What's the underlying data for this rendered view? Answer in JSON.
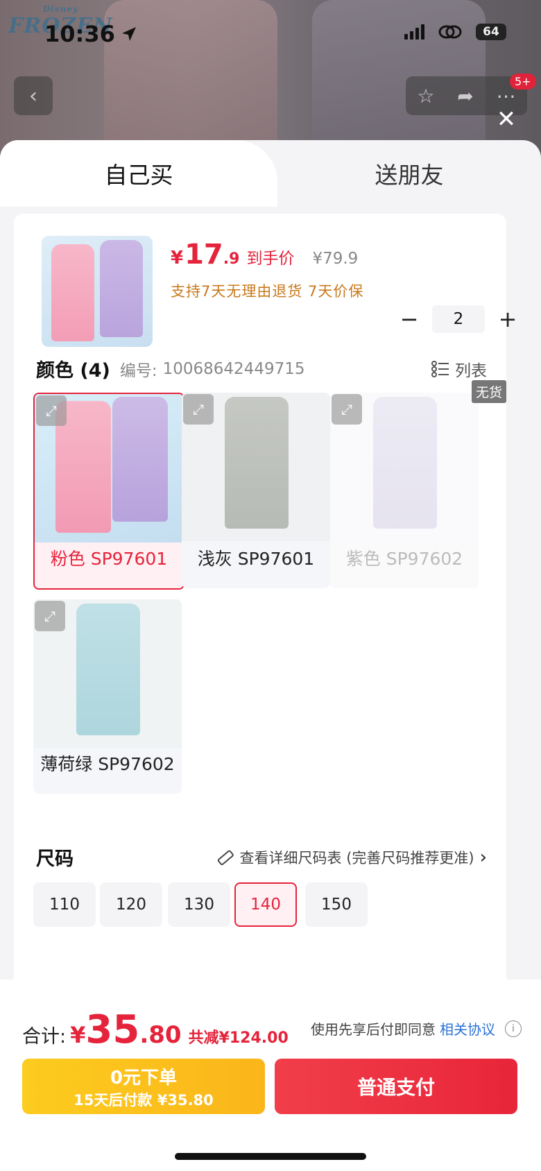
{
  "status_bar": {
    "time": "10:36",
    "battery": "64"
  },
  "background_page": {
    "logo_small": "Disney",
    "logo": "FROZEN",
    "notification_badge": "5+"
  },
  "tabs": {
    "buy_self": "自己买",
    "gift_friend": "送朋友"
  },
  "product": {
    "price_symbol": "¥",
    "price_int": "17",
    "price_dec": ".9",
    "price_tag": "到手价",
    "original_price": "¥79.9",
    "promise": "支持7天无理由退货  7天价保",
    "quantity": "2",
    "minus": "−",
    "plus": "+"
  },
  "color_section": {
    "title": "颜色 (4)",
    "code_label": "编号:",
    "code": "10068642449715",
    "list_label": "列表",
    "out_of_stock_tag": "无货",
    "options": [
      {
        "label": "粉色 SP97601",
        "state": "selected"
      },
      {
        "label": "浅灰 SP97601",
        "state": "normal"
      },
      {
        "label": "紫色 SP97602",
        "state": "disabled"
      },
      {
        "label": "薄荷绿 SP97602",
        "state": "normal"
      }
    ]
  },
  "size_section": {
    "title": "尺码",
    "guide": "查看详细尺码表 (完善尺码推荐更准)",
    "options": [
      "110",
      "120",
      "130",
      "140",
      "150"
    ],
    "selected": "140"
  },
  "footer": {
    "total_label": "合计:",
    "total_symbol": "¥",
    "total_int": "35",
    "total_dec": ".80",
    "discount": "共减¥124.00",
    "agree_text": "使用先享后付即同意",
    "agree_link": "相关协议",
    "btn_left_line1": "0元下单",
    "btn_left_line2": "15天后付款 ¥35.80",
    "btn_right": "普通支付"
  },
  "colors": {
    "accent": "#e5233b",
    "promise": "#c8781a",
    "pay_later": "#fbb51a",
    "link": "#2a72d8"
  }
}
